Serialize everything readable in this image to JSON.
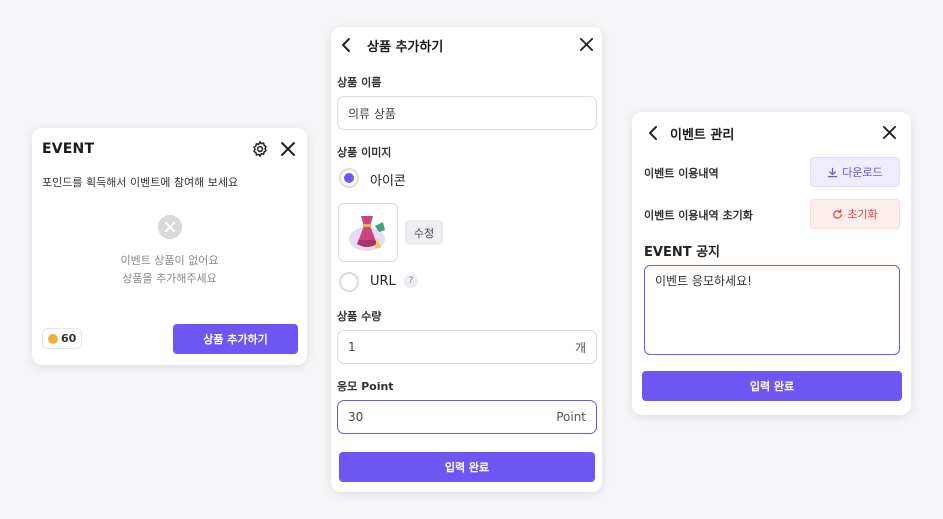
{
  "event_card": {
    "title": "EVENT",
    "description": "포인드를 획득해서 이벤트에 참여해 보세요",
    "empty_line1": "이벤트 상품이 없어요",
    "empty_line2": "상품을 추가해주세요",
    "points": "60",
    "add_button": "상품 추가하기"
  },
  "add_card": {
    "title": "상품 추가하기",
    "name_label": "상품 이름",
    "name_value": "의류 상품",
    "image_label": "상품 이미지",
    "option_icon": "아이콘",
    "option_url": "URL",
    "selected_option": "아이콘",
    "edit_button": "수정",
    "help_mark": "?",
    "quantity_label": "상품 수량",
    "quantity_value": "1",
    "quantity_unit": "개",
    "point_label": "응모 Point",
    "point_value": "30",
    "point_unit": "Point",
    "submit": "입력 완료"
  },
  "manage_card": {
    "title": "이벤트 관리",
    "history_label": "이벤트 이용내역",
    "download_button": "다운로드",
    "reset_label": "이벤트 이용내역 초기화",
    "reset_button": "초기화",
    "notice_title": "EVENT 공지",
    "notice_value": "이벤트 응모하세요!",
    "submit": "입력 완료"
  },
  "colors": {
    "accent": "#6e56f3",
    "danger": "#e54848",
    "coin": "#f0b33a"
  },
  "icons": [
    "gear-icon",
    "close-icon",
    "back-icon",
    "empty-x-icon",
    "coin-icon",
    "dress-icon",
    "download-icon",
    "refresh-icon"
  ]
}
